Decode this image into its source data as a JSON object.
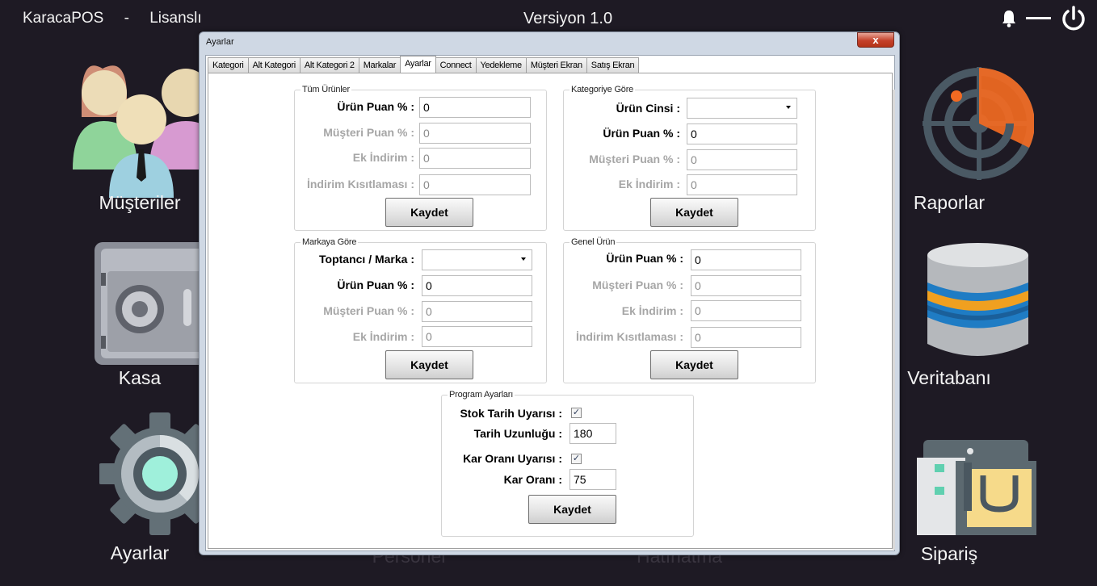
{
  "topbar": {
    "app_name": "KaracaPOS",
    "separator": "-",
    "license": "Lisanslı",
    "version": "Versiyon 1.0"
  },
  "tiles": {
    "musteriler": "Müşteriler",
    "kasa": "Kasa",
    "ayarlar": "Ayarlar",
    "raporlar": "Raporlar",
    "veritabani": "Veritabanı",
    "siparis": "Sipariş",
    "personel_partial": "Personel",
    "hatirlatma_partial": "Hatırlatma"
  },
  "dialog": {
    "title": "Ayarlar",
    "close_label": "x",
    "tabs": [
      "Kategori",
      "Alt Kategori",
      "Alt Kategori 2",
      "Markalar",
      "Ayarlar",
      "Connect",
      "Yedekleme",
      "Müşteri Ekran",
      "Satış Ekran"
    ],
    "active_tab": "Ayarlar"
  },
  "tum_urunler": {
    "title": "Tüm Ürünler",
    "urun_puan_label": "Ürün Puan % :",
    "urun_puan_value": "0",
    "musteri_puan_label": "Müşteri Puan % :",
    "musteri_puan_value": "0",
    "ek_indirim_label": "Ek İndirim :",
    "ek_indirim_value": "0",
    "indirim_kisitlamasi_label": "İndirim Kısıtlaması :",
    "indirim_kisitlamasi_value": "0",
    "save_label": "Kaydet"
  },
  "kategoriye_gore": {
    "title": "Kategoriye Göre",
    "urun_cinsi_label": "Ürün Cinsi :",
    "urun_cinsi_value": "",
    "urun_puan_label": "Ürün Puan % :",
    "urun_puan_value": "0",
    "musteri_puan_label": "Müşteri Puan % :",
    "musteri_puan_value": "0",
    "ek_indirim_label": "Ek İndirim :",
    "ek_indirim_value": "0",
    "save_label": "Kaydet"
  },
  "markaya_gore": {
    "title": "Markaya Göre",
    "toptanci_label": "Toptancı / Marka :",
    "toptanci_value": "",
    "urun_puan_label": "Ürün Puan % :",
    "urun_puan_value": "0",
    "musteri_puan_label": "Müşteri Puan % :",
    "musteri_puan_value": "0",
    "ek_indirim_label": "Ek İndirim :",
    "ek_indirim_value": "0",
    "save_label": "Kaydet"
  },
  "genel_urun": {
    "title": "Genel Ürün",
    "urun_puan_label": "Ürün Puan % :",
    "urun_puan_value": "0",
    "musteri_puan_label": "Müşteri Puan % :",
    "musteri_puan_value": "0",
    "ek_indirim_label": "Ek İndirim :",
    "ek_indirim_value": "0",
    "indirim_kisitlamasi_label": "İndirim Kısıtlaması :",
    "indirim_kisitlamasi_value": "0",
    "save_label": "Kaydet"
  },
  "program_ayarlari": {
    "title": "Program Ayarları",
    "stok_tarih_label": "Stok Tarih Uyarısı :",
    "stok_tarih_checked": true,
    "tarih_uzunlugu_label": "Tarih Uzunluğu :",
    "tarih_uzunlugu_value": "180",
    "kar_orani_uyarisi_label": "Kar Oranı Uyarısı :",
    "kar_orani_uyarisi_checked": true,
    "kar_orani_label": "Kar Oranı :",
    "kar_orani_value": "75",
    "save_label": "Kaydet",
    "check_mark": "✓"
  }
}
